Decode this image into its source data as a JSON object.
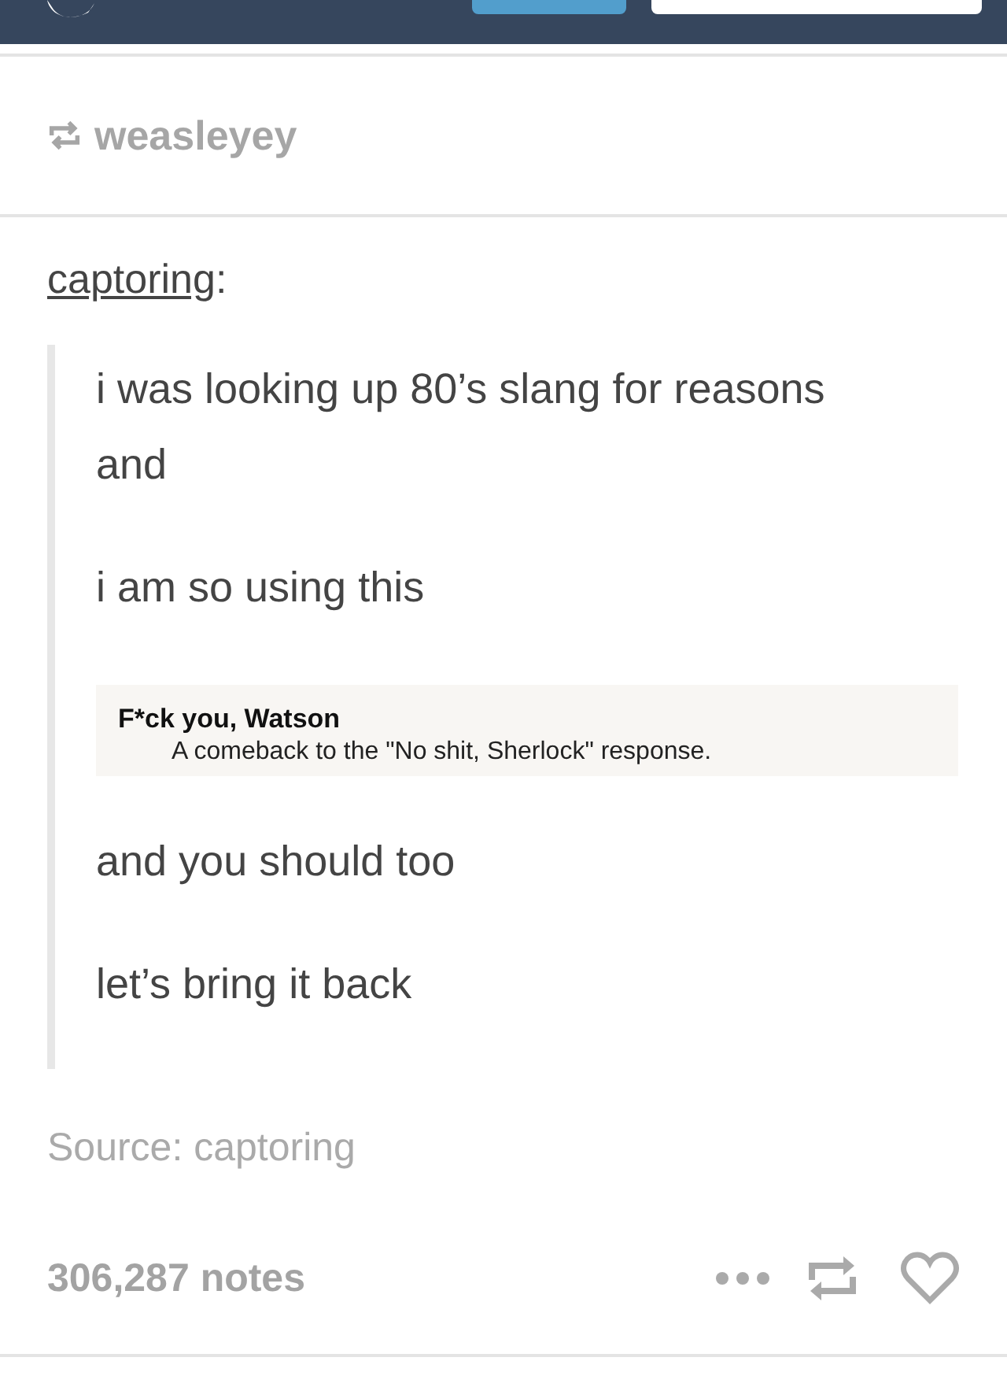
{
  "reblogged_by": "weasleyey",
  "post": {
    "author": "captoring",
    "author_suffix": ":",
    "body": [
      {
        "kind": "text",
        "text": "i was looking up 80’s slang for reasons"
      },
      {
        "kind": "text",
        "text": "and"
      },
      {
        "kind": "text",
        "text": "i am so using this"
      },
      {
        "kind": "card",
        "term": "F*ck you, Watson",
        "definition": "A comeback to the \"No shit, Sherlock\" response."
      },
      {
        "kind": "text",
        "text": "and you should too"
      },
      {
        "kind": "text",
        "text": "let’s bring it back"
      }
    ],
    "source": "Source: captoring"
  },
  "notes": "306,287 notes"
}
